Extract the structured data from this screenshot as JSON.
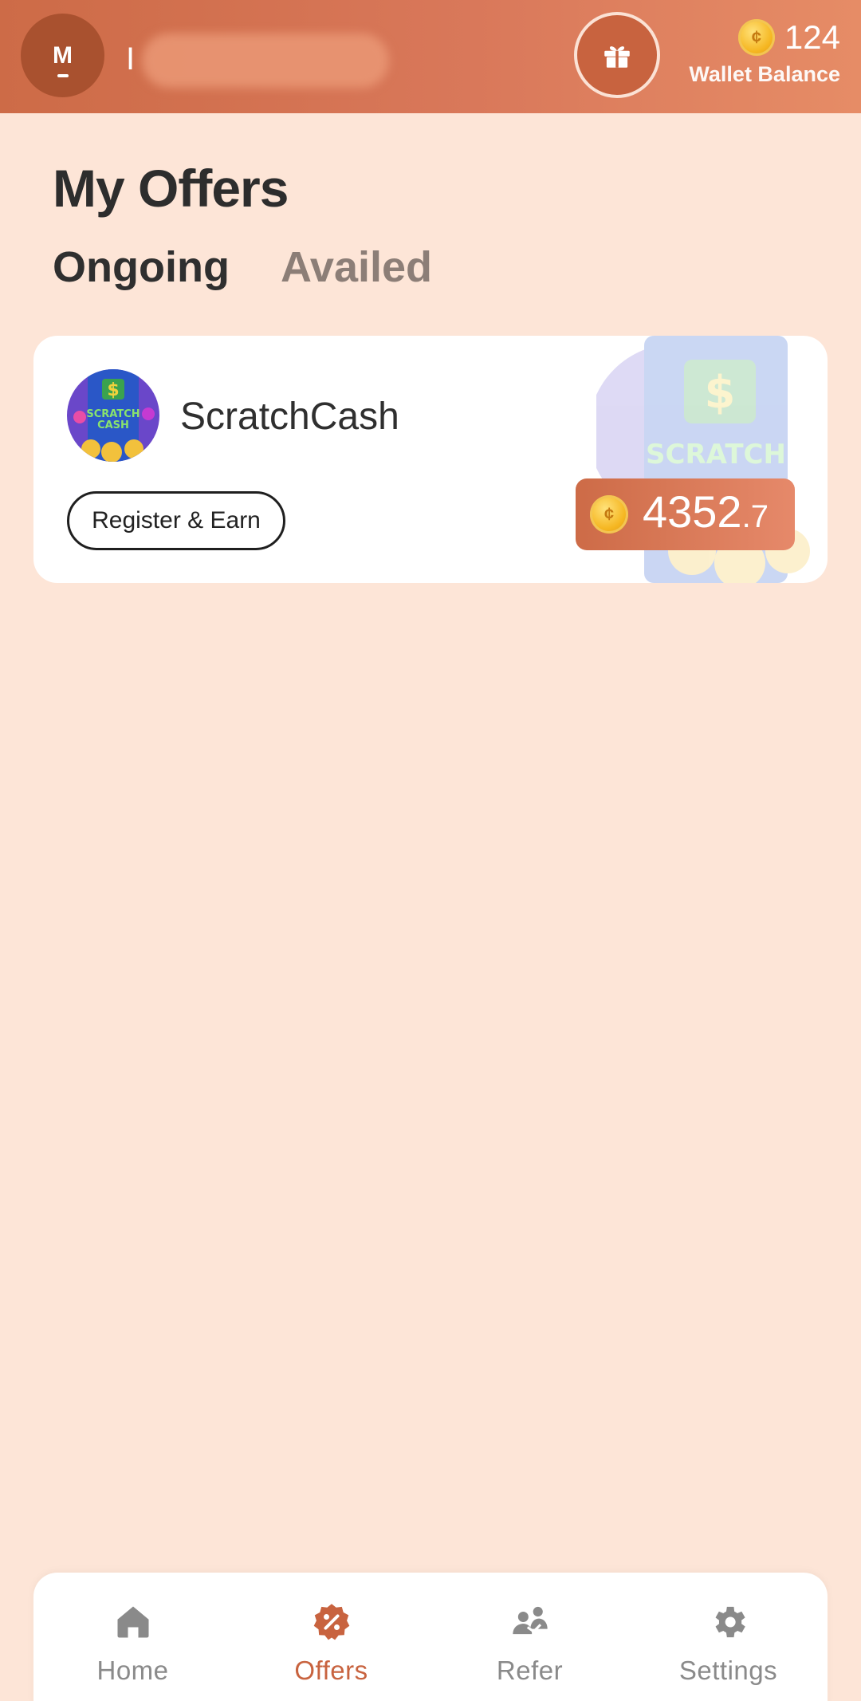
{
  "header": {
    "avatar_initial": "M",
    "username": "I",
    "wallet_amount": "124",
    "wallet_label": "Wallet Balance",
    "coin_symbol": "¢"
  },
  "page": {
    "title": "My Offers",
    "tabs": [
      {
        "label": "Ongoing",
        "active": true
      },
      {
        "label": "Availed",
        "active": false
      }
    ]
  },
  "offers": [
    {
      "app_name": "ScratchCash",
      "logo_icon": "scratchcash-logo",
      "action_label": "Register & Earn",
      "reward_whole": "4352",
      "reward_decimal": ".7"
    }
  ],
  "bottom_nav": [
    {
      "label": "Home",
      "icon": "home-icon",
      "active": false
    },
    {
      "label": "Offers",
      "icon": "offers-icon",
      "active": true
    },
    {
      "label": "Refer",
      "icon": "refer-icon",
      "active": false
    },
    {
      "label": "Settings",
      "icon": "settings-icon",
      "active": false
    }
  ],
  "colors": {
    "background": "#fde5d7",
    "accent": "#c8633f",
    "header_start": "#cd6b47",
    "header_end": "#e68c66",
    "inactive_nav": "#8a8a8a"
  }
}
